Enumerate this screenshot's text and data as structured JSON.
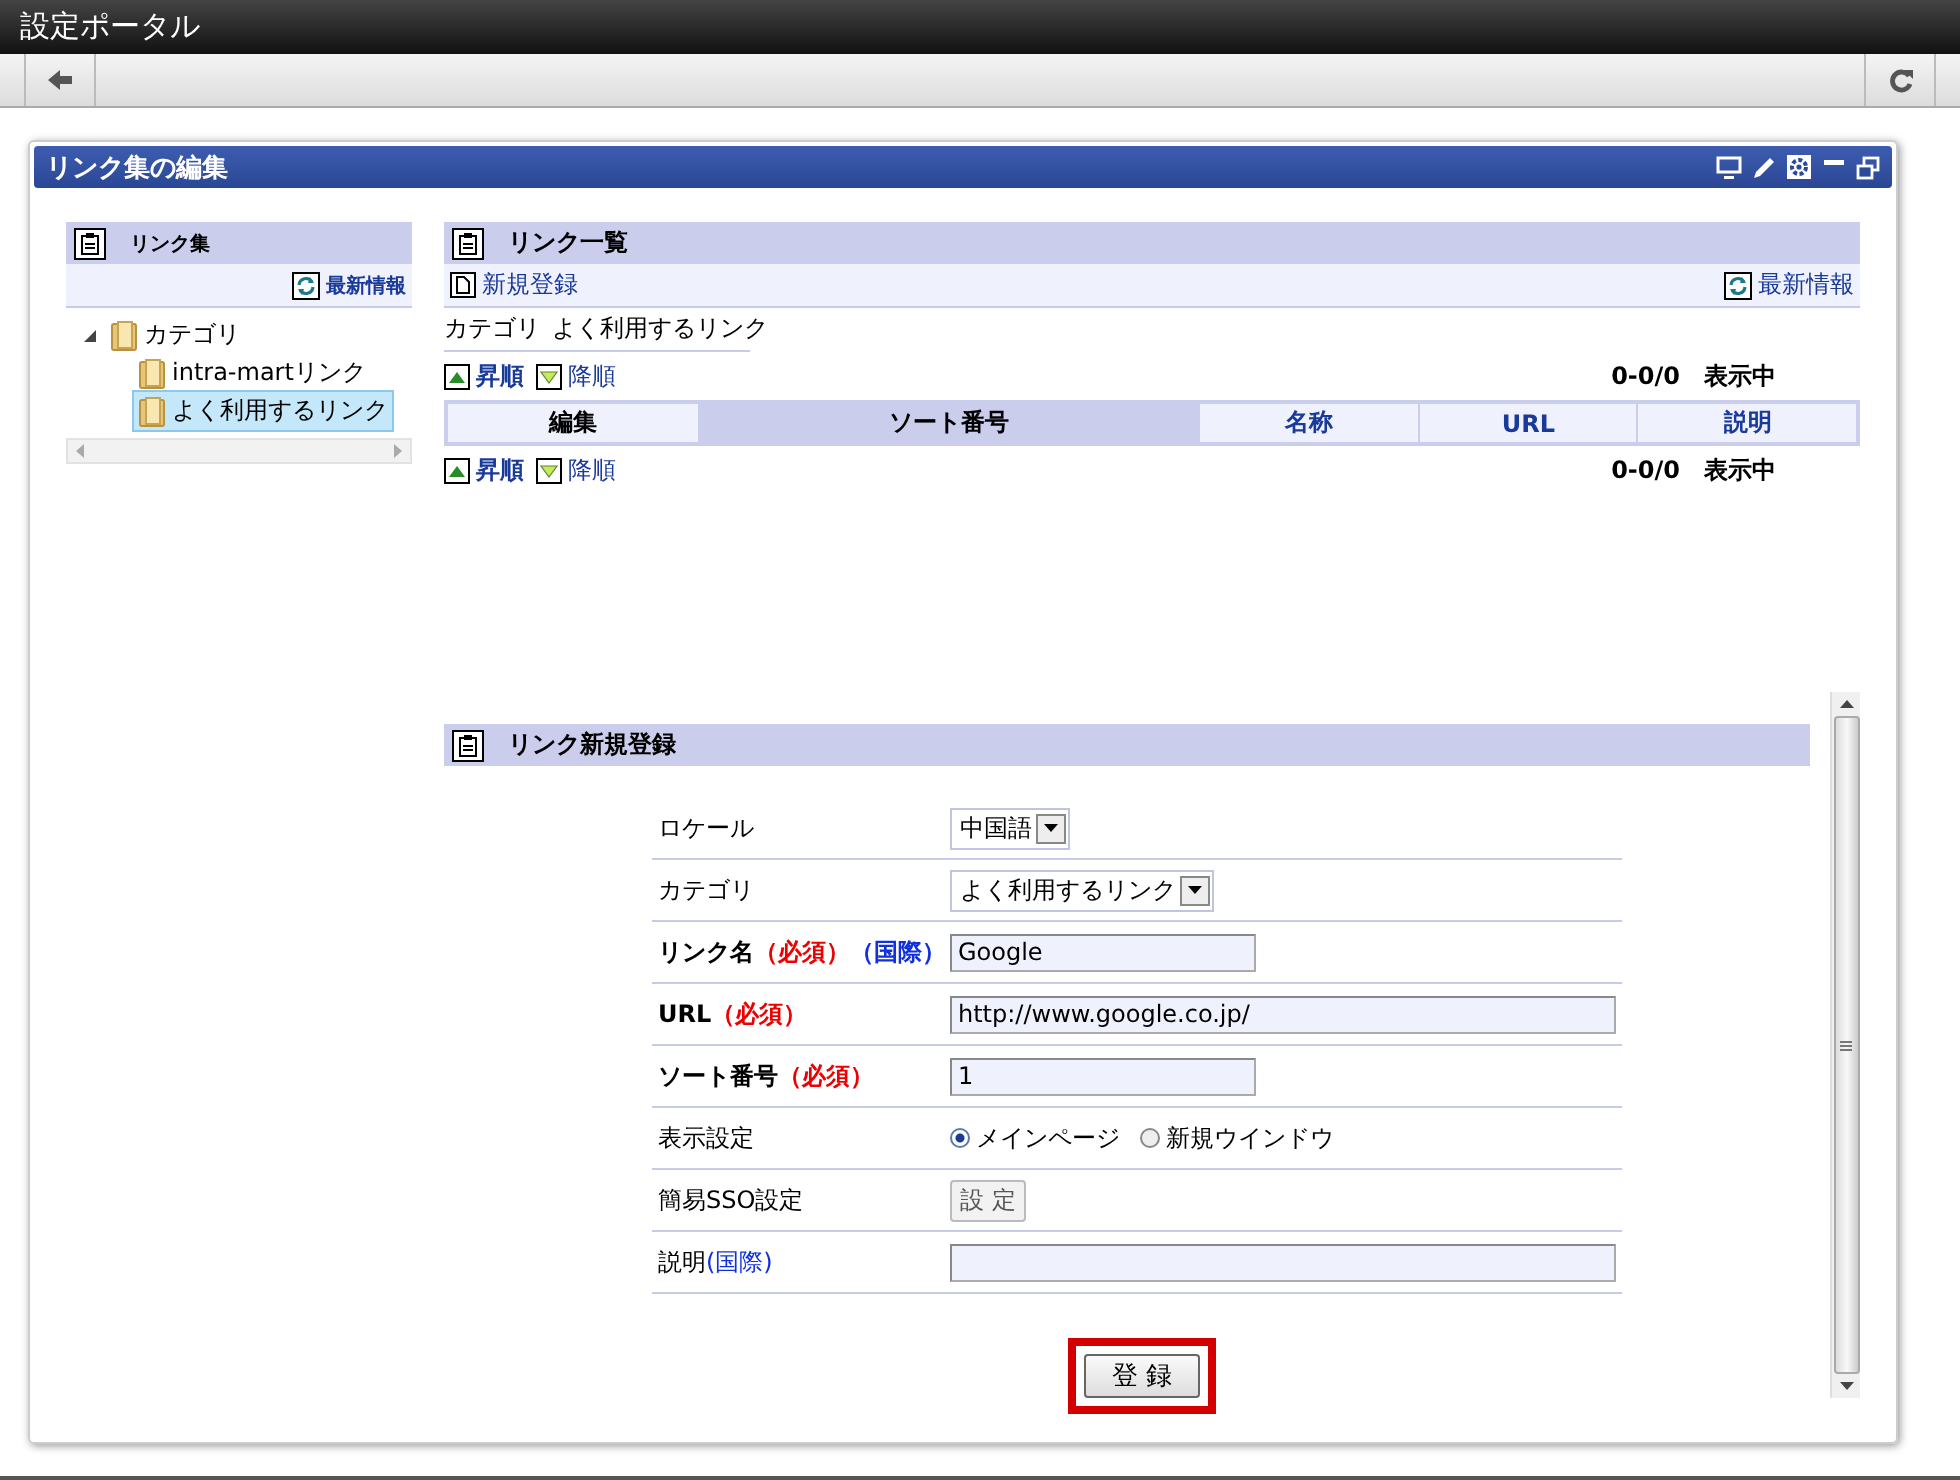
{
  "window": {
    "title": "設定ポータル"
  },
  "portlet": {
    "title": "リンク集の編集"
  },
  "tree_panel": {
    "title": "リンク集",
    "refresh": "最新情報",
    "tree": [
      {
        "label": "カテゴリ",
        "expanded": true,
        "selected": false,
        "children": [
          {
            "label": "intra-martリンク",
            "selected": false
          },
          {
            "label": "よく利用するリンク",
            "selected": true
          }
        ]
      }
    ]
  },
  "list_panel": {
    "title": "リンク一覧",
    "new": "新規登録",
    "refresh": "最新情報",
    "category_label": "カテゴリ",
    "category_value": "よく利用するリンク",
    "sort_bars": [
      {
        "asc": "昇順",
        "desc": "降順",
        "count": "0-0/0",
        "suffix": "表示中"
      },
      {
        "asc": "昇順",
        "desc": "降順",
        "count": "0-0/0",
        "suffix": "表示中"
      }
    ],
    "columns": [
      {
        "label": "編集",
        "kind": "plain",
        "sorted": false
      },
      {
        "label": "ソート番号",
        "kind": "plain",
        "sorted": true
      },
      {
        "label": "名称",
        "kind": "link",
        "sorted": false
      },
      {
        "label": "URL",
        "kind": "link",
        "sorted": false
      },
      {
        "label": "説明",
        "kind": "link",
        "sorted": false
      }
    ]
  },
  "form": {
    "title": "リンク新規登録",
    "rows": [
      {
        "label": [
          {
            "text": "ロケール",
            "kind": "plain"
          }
        ],
        "bold": false,
        "kind": "select",
        "value": "中国語"
      },
      {
        "label": [
          {
            "text": "カテゴリ",
            "kind": "plain"
          }
        ],
        "bold": false,
        "kind": "select",
        "value": "よく利用するリンク"
      },
      {
        "label": [
          {
            "text": "リンク名",
            "kind": "plain"
          },
          {
            "text": "（必須）",
            "kind": "required"
          },
          {
            "text": "（国際）",
            "kind": "intl"
          }
        ],
        "bold": true,
        "kind": "text",
        "value": "Google"
      },
      {
        "label": [
          {
            "text": "URL",
            "kind": "plain"
          },
          {
            "text": "（必須）",
            "kind": "required"
          }
        ],
        "bold": true,
        "kind": "wide",
        "value": "http://www.google.co.jp/"
      },
      {
        "label": [
          {
            "text": "ソート番号",
            "kind": "plain"
          },
          {
            "text": "（必須）",
            "kind": "required"
          }
        ],
        "bold": true,
        "kind": "text",
        "value": "1"
      },
      {
        "label": [
          {
            "text": "表示設定",
            "kind": "plain"
          }
        ],
        "bold": false,
        "kind": "radio",
        "options": [
          {
            "label": "メインページ",
            "selected": true
          },
          {
            "label": "新規ウインドウ",
            "selected": false
          }
        ]
      },
      {
        "label": [
          {
            "text": "簡易SSO設定",
            "kind": "plain"
          }
        ],
        "bold": false,
        "kind": "button",
        "value": "設 定"
      },
      {
        "label": [
          {
            "text": "説明",
            "kind": "plain"
          },
          {
            "text": "(国際)",
            "kind": "intl"
          }
        ],
        "bold": false,
        "kind": "wide"
      }
    ],
    "submit": "登 録",
    "submit_highlighted": true
  }
}
